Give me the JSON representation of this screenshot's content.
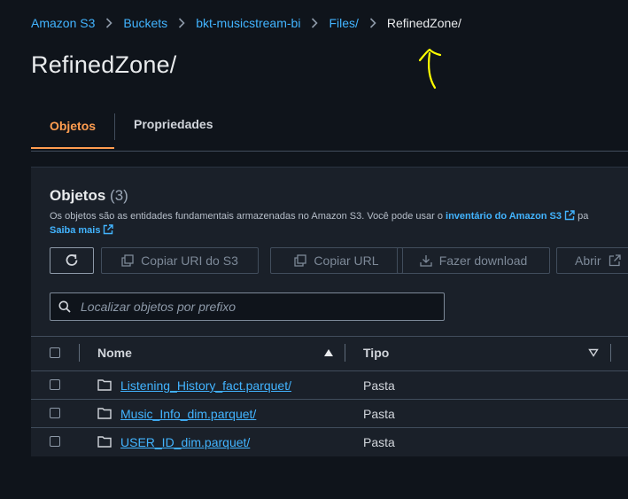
{
  "breadcrumb": {
    "items": [
      "Amazon S3",
      "Buckets",
      "bkt-musicstream-bi",
      "Files/"
    ],
    "current": "RefinedZone/"
  },
  "page": {
    "title": "RefinedZone/"
  },
  "tabs": [
    {
      "label": "Objetos",
      "active": true
    },
    {
      "label": "Propriedades",
      "active": false
    }
  ],
  "objects_panel": {
    "title": "Objetos",
    "count": "(3)",
    "description_prefix": "Os objetos são as entidades fundamentais armazenadas no Amazon S3. Você pode usar o ",
    "inventory_link": "inventário do Amazon S3",
    "description_suffix": " pa",
    "learn_more": "Saiba mais"
  },
  "toolbar": {
    "copy_uri": "Copiar URI do S3",
    "copy_url": "Copiar URL",
    "download": "Fazer download",
    "open": "Abrir"
  },
  "search": {
    "placeholder": "Localizar objetos por prefixo"
  },
  "table": {
    "columns": [
      "Nome",
      "Tipo"
    ],
    "rows": [
      {
        "name": "Listening_History_fact.parquet/",
        "type": "Pasta"
      },
      {
        "name": "Music_Info_dim.parquet/",
        "type": "Pasta"
      },
      {
        "name": "USER_ID_dim.parquet/",
        "type": "Pasta"
      }
    ]
  },
  "colors": {
    "link": "#42b4ff",
    "active_tab": "#ff9d50",
    "annotation": "#ffff00",
    "background": "#0f141b"
  },
  "icons": [
    "chevron-right-icon",
    "external-link-icon",
    "refresh-icon",
    "copy-icon",
    "download-icon",
    "search-icon",
    "sort-ascending-icon",
    "filter-down-icon",
    "folder-icon"
  ]
}
